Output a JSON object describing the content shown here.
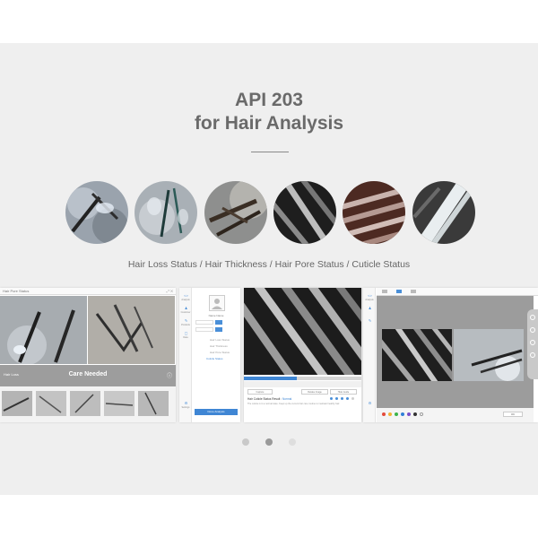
{
  "header": {
    "title_line1": "API 203",
    "title_line2": "for Hair Analysis"
  },
  "circles": [
    {
      "name": "hair-loss-sample-1"
    },
    {
      "name": "hair-loss-sample-2"
    },
    {
      "name": "hair-thickness-sample"
    },
    {
      "name": "hair-pore-sample-1"
    },
    {
      "name": "hair-pore-sample-2"
    },
    {
      "name": "cuticle-sample"
    }
  ],
  "caption": "Hair Loss Status / Hair Thickness / Hair Pore Status / Cuticle Status",
  "screens": {
    "pore": {
      "title": "Hair Pore Status",
      "window_controls": "⤢ ✕",
      "status_label": "Care Needed",
      "left_meta": "Hair Loss",
      "right_meta": "ⓘ"
    },
    "profile": {
      "menu": [
        {
          "icon": "<>",
          "label": "Analysis"
        },
        {
          "icon": "♟",
          "label": "Customer"
        },
        {
          "icon": "✎",
          "label": "Products"
        },
        {
          "icon": "▢",
          "label": "Data"
        },
        {
          "icon": "⚙",
          "label": "Settings"
        }
      ],
      "user_name": "Name Name",
      "options": [
        "Hair Loss Status",
        "Hair Thickness",
        "Hair Pore Status",
        "Cuticle Status"
      ],
      "selected_option": "Cuticle Status",
      "button_label": "Done Analysis"
    },
    "cuticle": {
      "result_label": "Hair Cuticle Status Result :",
      "result_value": "Normal",
      "result_desc": "The cuticle is in a normal state. Keep up the current hair care routine to maintain healthy hair.",
      "buttons": [
        "Capture",
        "Retake Image",
        "Hide Guide"
      ],
      "progress_percent": 45,
      "rating": 4
    },
    "compare": {
      "ok_label": "OK",
      "palette": [
        "#e34a3a",
        "#f2b233",
        "#3bb34a",
        "#2f7fd6",
        "#7a4fc9",
        "#333333",
        "#ffffff"
      ]
    }
  },
  "carousel": {
    "pages": 3,
    "active": 1,
    "active_color": "#9a9a9a",
    "inactive_color": "#c9c9c9",
    "tertiary_color": "#dedede"
  },
  "colors": {
    "background": "#efefef",
    "accent": "#3f86d4",
    "title": "#6a6a6a"
  }
}
